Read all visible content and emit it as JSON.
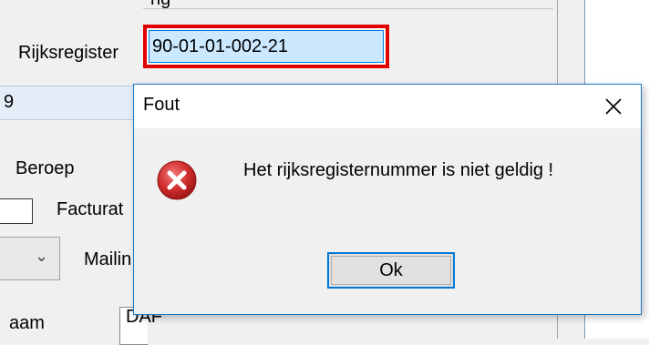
{
  "form": {
    "top_partial_text": "ng",
    "rijksregister_label": "Rijksregister",
    "rijksregister_value": "90-01-01-002-21",
    "left_field_value": "9",
    "beroep_label": "Beroep",
    "facturatie_label": "Facturat",
    "mailing_label": "Mailin",
    "naam_label": "aam",
    "naam_value": "DAF"
  },
  "dialog": {
    "title": "Fout",
    "message": "Het rijksregisternummer is niet geldig !",
    "ok_label": "Ok",
    "icon": "error-icon",
    "close_icon": "close-icon"
  },
  "colors": {
    "highlight_border": "#e00000",
    "selection_fill": "#cce8ff",
    "accent": "#0078d7",
    "error_red": "#d12e2e"
  }
}
